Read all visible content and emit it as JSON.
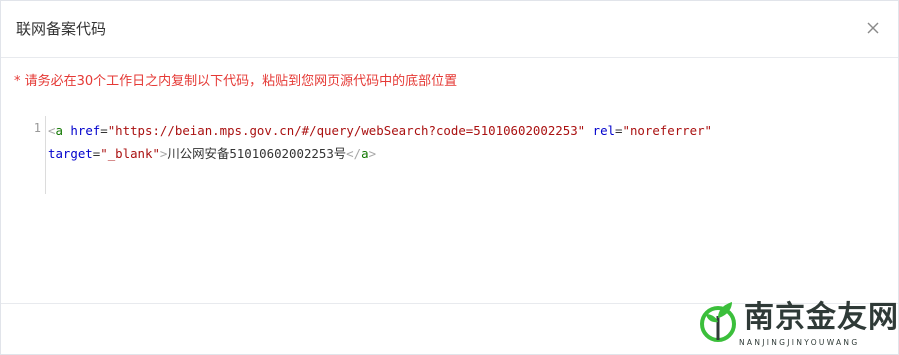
{
  "dialog": {
    "title": "联网备案代码",
    "close_icon": "close-icon"
  },
  "notice": "* 请务必在30个工作日之内复制以下代码，粘贴到您网页源代码中的底部位置",
  "code": {
    "line_number": "1",
    "tag_open": "<",
    "tag_name": "a",
    "attr_href": "href",
    "eq": "=",
    "href_value": "\"https://beian.mps.gov.cn/#/query/webSearch?code=51010602002253\"",
    "attr_rel": "rel",
    "rel_value": "\"noreferrer\"",
    "attr_target": "target",
    "target_value": "\"_blank\"",
    "tag_close": ">",
    "link_text": "川公网安备51010602002253号",
    "end_tag_open": "</",
    "end_tag_close": ">"
  },
  "watermark": {
    "name": "南京金友网",
    "pinyin": "NANJINGJINYOUWANG",
    "logo_icon": "leaf-logo-icon",
    "accent": "#3bbf3b"
  }
}
